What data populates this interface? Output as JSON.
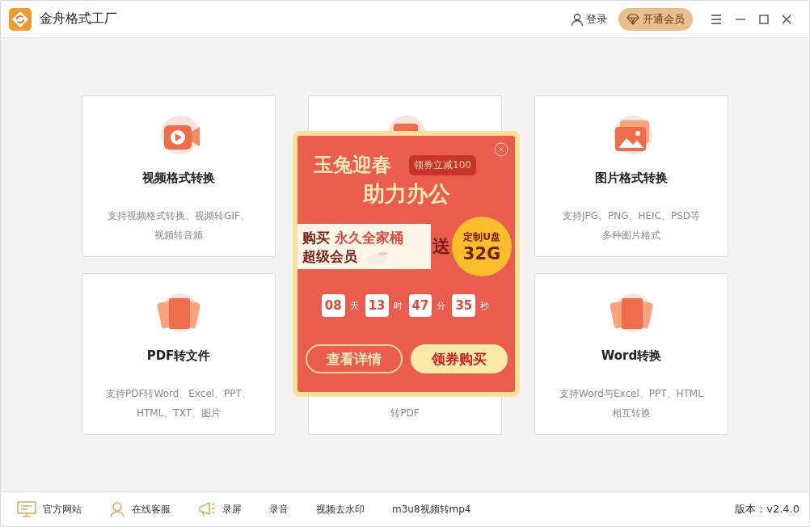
{
  "window": {
    "title": "金舟格式工厂",
    "login": "登录",
    "vip_button": "开通会员"
  },
  "cards": [
    {
      "kind": "video",
      "title": "视频格式转换",
      "desc": [
        "支持视频格式转换、视频转GIF、",
        "视频转音频"
      ]
    },
    {
      "kind": "doc"
    },
    {
      "kind": "image",
      "title": "图片格式转换",
      "desc": [
        "支持JPG、PNG、HEIC、PSD等",
        "多种图片格式"
      ]
    },
    {
      "kind": "pdf",
      "title": "PDF转文件",
      "desc": [
        "支持PDF转Word、Excel、PPT、",
        "HTML、TXT、图片"
      ]
    },
    {
      "kind": "doc",
      "desc": [
        "转PDF"
      ]
    },
    {
      "kind": "word",
      "title": "Word转换",
      "desc": [
        "支持Word与Excel、PPT、HTML",
        "相互转换"
      ]
    }
  ],
  "popup": {
    "headline_1": "玉兔迎春",
    "headline_2": "助力办公",
    "coupon_tag": "领券立减100",
    "offer_line_1": {
      "verb": "购买",
      "product": "永久全家桶"
    },
    "offer_line_2": "超级会员",
    "gift_word": "送",
    "gift_line_1": "定制U盘",
    "gift_line_2": "32G",
    "countdown": [
      {
        "value": "08",
        "unit": "天"
      },
      {
        "value": "13",
        "unit": "时"
      },
      {
        "value": "47",
        "unit": "分"
      },
      {
        "value": "35",
        "unit": "秒"
      }
    ],
    "details_button": "查看详情",
    "buy_button": "领券购买"
  },
  "footer": {
    "links": [
      {
        "kind": "monitor",
        "label": "官方网站"
      },
      {
        "kind": "person",
        "label": "在线客服"
      },
      {
        "kind": "megaphone",
        "label": "录屏"
      },
      {
        "kind": "plain",
        "label": "录音"
      },
      {
        "kind": "plain",
        "label": "视频去水印"
      },
      {
        "kind": "plain",
        "label": "m3u8视频转mp4"
      }
    ],
    "version": "版本：v2.4.0"
  }
}
